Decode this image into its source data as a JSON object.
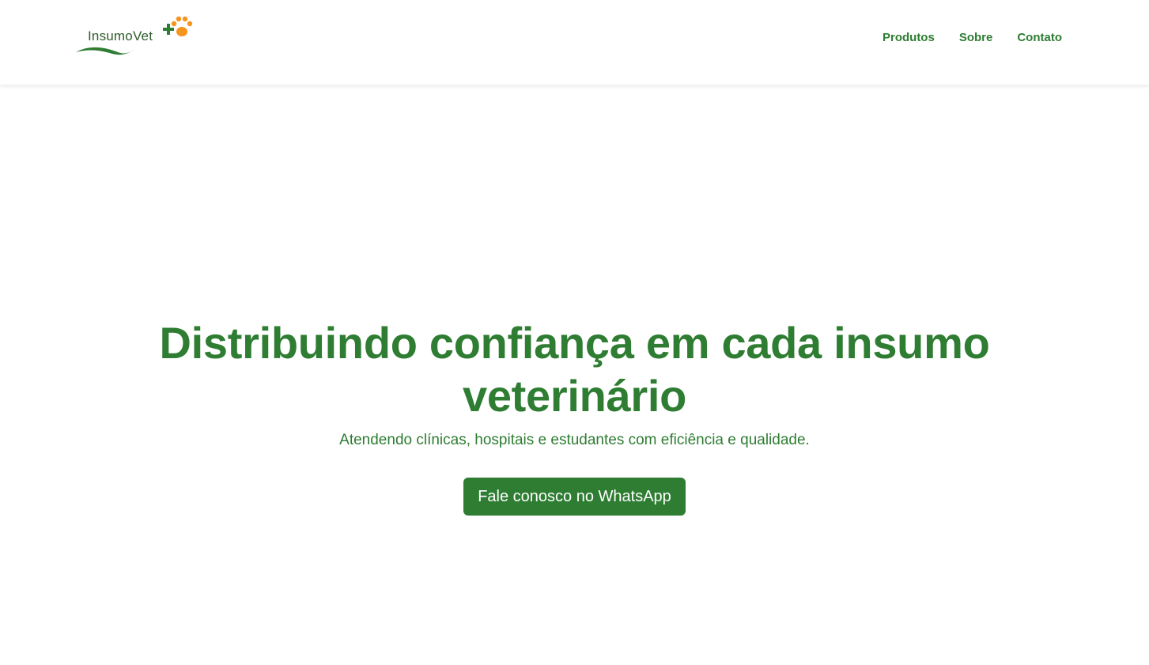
{
  "brand": {
    "name": "InsumoVet",
    "primary_color": "#2e7d32",
    "accent_color": "#f7941d",
    "logo_icons": [
      "plus-icon",
      "paw-icon",
      "swoosh"
    ]
  },
  "nav": {
    "items": [
      {
        "label": "Produtos"
      },
      {
        "label": "Sobre"
      },
      {
        "label": "Contato"
      }
    ]
  },
  "hero": {
    "title": "Distribuindo confiança em cada insumo veterinário",
    "subtitle": "Atendendo clínicas, hospitais e estudantes com eficiência e qualidade.",
    "cta_label": "Fale conosco no WhatsApp"
  }
}
